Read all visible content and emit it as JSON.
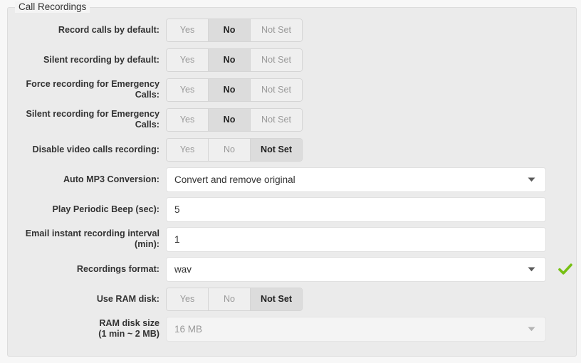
{
  "fieldset": {
    "legend": "Call Recordings"
  },
  "colors": {
    "panel_bg": "#ebebeb",
    "page_bg": "#f7f7f7",
    "active_button_bg": "#dcdcdc",
    "valid_check": "#76c013",
    "label_text": "#333333",
    "muted_text": "#9a9a9a"
  },
  "toggle_options": [
    "Yes",
    "No",
    "Not Set"
  ],
  "rows": [
    {
      "label": "Record calls by default:",
      "type": "toggle",
      "options": [
        "Yes",
        "No",
        "Not Set"
      ],
      "selected": "No"
    },
    {
      "label": "Silent recording by default:",
      "type": "toggle",
      "options": [
        "Yes",
        "No",
        "Not Set"
      ],
      "selected": "No"
    },
    {
      "label": "Force recording for Emergency\nCalls:",
      "type": "toggle",
      "options": [
        "Yes",
        "No",
        "Not Set"
      ],
      "selected": "No"
    },
    {
      "label": "Silent recording for Emergency\nCalls:",
      "type": "toggle",
      "options": [
        "Yes",
        "No",
        "Not Set"
      ],
      "selected": "No"
    },
    {
      "label": "Disable video calls recording:",
      "type": "toggle",
      "options": [
        "Yes",
        "No",
        "Not Set"
      ],
      "selected": "Not Set"
    },
    {
      "label": "Auto MP3 Conversion:",
      "type": "select",
      "value": "Convert and remove original",
      "disabled": false,
      "check": false
    },
    {
      "label": "Play Periodic Beep (sec):",
      "type": "text",
      "value": "5",
      "placeholder": ""
    },
    {
      "label": "Email instant recording interval\n(min):",
      "type": "text",
      "value": "1",
      "placeholder": ""
    },
    {
      "label": "Recordings format:",
      "type": "select",
      "value": "wav",
      "disabled": false,
      "check": true
    },
    {
      "label": "Use RAM disk:",
      "type": "toggle",
      "options": [
        "Yes",
        "No",
        "Not Set"
      ],
      "selected": "Not Set"
    },
    {
      "label": "RAM disk size\n(1 min ~ 2 MB)",
      "type": "select",
      "value": "16 MB",
      "disabled": true,
      "check": false
    }
  ]
}
